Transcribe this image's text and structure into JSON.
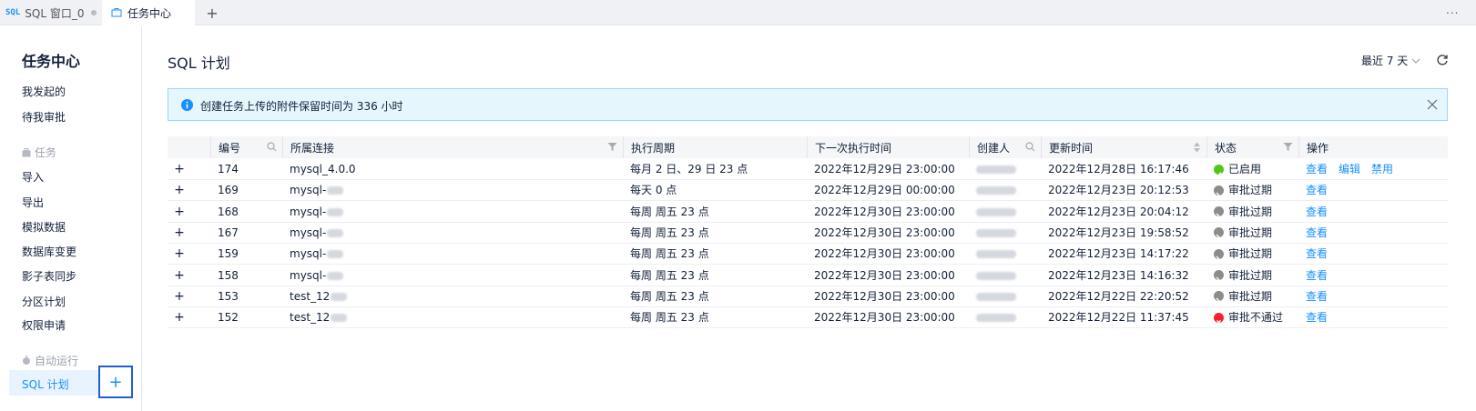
{
  "tabs": [
    {
      "badge": "SQL",
      "label": "SQL 窗口_0"
    },
    {
      "label": "任务中心"
    }
  ],
  "tab_add_label": "+",
  "tab_more_label": "...",
  "sidebar": {
    "title": "任务中心",
    "items_top": [
      "我发起的",
      "待我审批"
    ],
    "group_task": "任务",
    "task_items": [
      "导入",
      "导出",
      "模拟数据",
      "数据库变更",
      "影子表同步",
      "分区计划",
      "权限申请"
    ],
    "group_auto": "自动运行",
    "active_item": "SQL 计划",
    "add_label": "+"
  },
  "main": {
    "title": "SQL 计划",
    "range": "最近 7 天"
  },
  "alert": {
    "text": "创建任务上传的附件保留时间为 336 小时"
  },
  "table": {
    "columns": [
      "编号",
      "所属连接",
      "执行周期",
      "下一次执行时间",
      "创建人",
      "更新时间",
      "状态",
      "操作"
    ],
    "rows": [
      {
        "id": "174",
        "conn": "mysql_4.0.0",
        "cycle": "每月 2 日、29 日 23 点",
        "next": "2022年12月29日 23:00:00",
        "updated": "2022年12月28日 16:17:46",
        "status": "已启用",
        "status_kind": "enabled",
        "actions": [
          "查看",
          "编辑",
          "禁用"
        ]
      },
      {
        "id": "169",
        "conn": "mysql-",
        "cycle": "每天 0 点",
        "next": "2022年12月29日 00:00:00",
        "updated": "2022年12月23日 20:12:53",
        "status": "审批过期",
        "status_kind": "expired",
        "actions": [
          "查看"
        ]
      },
      {
        "id": "168",
        "conn": "mysql-",
        "cycle": "每周 周五 23 点",
        "next": "2022年12月30日 23:00:00",
        "updated": "2022年12月23日 20:04:12",
        "status": "审批过期",
        "status_kind": "expired",
        "actions": [
          "查看"
        ]
      },
      {
        "id": "167",
        "conn": "mysql-",
        "cycle": "每周 周五 23 点",
        "next": "2022年12月30日 23:00:00",
        "updated": "2022年12月23日 19:58:52",
        "status": "审批过期",
        "status_kind": "expired",
        "actions": [
          "查看"
        ]
      },
      {
        "id": "159",
        "conn": "mysql-",
        "cycle": "每周 周五 23 点",
        "next": "2022年12月30日 23:00:00",
        "updated": "2022年12月23日 14:17:22",
        "status": "审批过期",
        "status_kind": "expired",
        "actions": [
          "查看"
        ]
      },
      {
        "id": "158",
        "conn": "mysql-",
        "cycle": "每周 周五 23 点",
        "next": "2022年12月30日 23:00:00",
        "updated": "2022年12月23日 14:16:32",
        "status": "审批过期",
        "status_kind": "expired",
        "actions": [
          "查看"
        ]
      },
      {
        "id": "153",
        "conn": "test_12",
        "cycle": "每周 周五 23 点",
        "next": "2022年12月30日 23:00:00",
        "updated": "2022年12月22日 22:20:52",
        "status": "审批过期",
        "status_kind": "expired",
        "actions": [
          "查看"
        ]
      },
      {
        "id": "152",
        "conn": "test_12",
        "cycle": "每周 周五 23 点",
        "next": "2022年12月30日 23:00:00",
        "updated": "2022年12月22日 11:37:45",
        "status": "审批不通过",
        "status_kind": "rejected",
        "actions": [
          "查看"
        ]
      }
    ]
  },
  "colors": {
    "accent": "#1890ff",
    "enabled": "#52c41a",
    "expired": "#8c8c8c",
    "rejected": "#f5222d",
    "alert_bg": "#e6f6fd",
    "alert_border": "#9bd8f4"
  },
  "icons": {
    "alert": "info-circle-icon",
    "refresh": "refresh-icon",
    "close": "close-icon",
    "filter": "filter-icon",
    "search": "search-icon",
    "sort": "sort-icon"
  }
}
